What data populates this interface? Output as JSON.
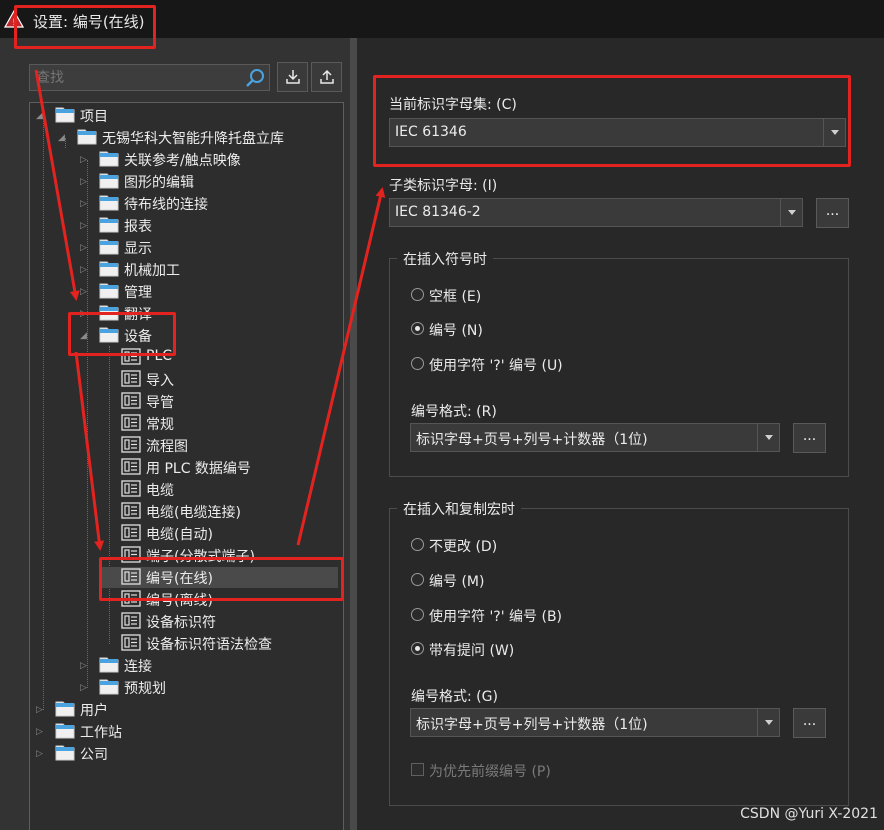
{
  "window": {
    "title": "设置: 编号(在线)"
  },
  "search": {
    "placeholder": "查找"
  },
  "toolbar": {
    "import_icon": "import-icon",
    "export_icon": "export-icon"
  },
  "tree": {
    "nodes": [
      {
        "label": "项目"
      },
      {
        "label": "无锡华科大智能升降托盘立库"
      },
      {
        "label": "关联参考/触点映像"
      },
      {
        "label": "图形的编辑"
      },
      {
        "label": "待布线的连接"
      },
      {
        "label": "报表"
      },
      {
        "label": "显示"
      },
      {
        "label": "机械加工"
      },
      {
        "label": "管理"
      },
      {
        "label": "翻译"
      },
      {
        "label": "设备"
      },
      {
        "label": "PLC"
      },
      {
        "label": "导入"
      },
      {
        "label": "导管"
      },
      {
        "label": "常规"
      },
      {
        "label": "流程图"
      },
      {
        "label": "用 PLC 数据编号"
      },
      {
        "label": "电缆"
      },
      {
        "label": "电缆(电缆连接)"
      },
      {
        "label": "电缆(自动)"
      },
      {
        "label": "端子(分散式端子)"
      },
      {
        "label": "编号(在线)"
      },
      {
        "label": "编号(离线)"
      },
      {
        "label": "设备标识符"
      },
      {
        "label": "设备标识符语法检查"
      },
      {
        "label": "连接"
      },
      {
        "label": "预规划"
      },
      {
        "label": "用户"
      },
      {
        "label": "工作站"
      },
      {
        "label": "公司"
      }
    ]
  },
  "settings": {
    "charset_label": "当前标识字母集: (C)",
    "charset_value": "IEC 61346",
    "subclass_label": "子类标识字母: (I)",
    "subclass_value": "IEC 81346-2",
    "dots": "...",
    "insert_symbol": {
      "title": "在插入符号时",
      "options": [
        "空框 (E)",
        "编号 (N)",
        "使用字符 '?' 编号 (U)"
      ],
      "selected": 1,
      "format_label": "编号格式: (R)",
      "format_value": "标识字母+页号+列号+计数器（1位)"
    },
    "insert_macro": {
      "title": "在插入和复制宏时",
      "options": [
        "不更改 (D)",
        "编号 (M)",
        "使用字符 '?' 编号 (B)",
        "带有提问 (W)"
      ],
      "selected": 3,
      "format_label": "编号格式: (G)",
      "format_value": "标识字母+页号+列号+计数器（1位)",
      "prefix_label": "为优先前缀编号 (P)"
    }
  },
  "watermark": "CSDN @Yuri X-2021",
  "colors": {
    "annotation": "#e3231f",
    "folder": "#4aa3df"
  }
}
